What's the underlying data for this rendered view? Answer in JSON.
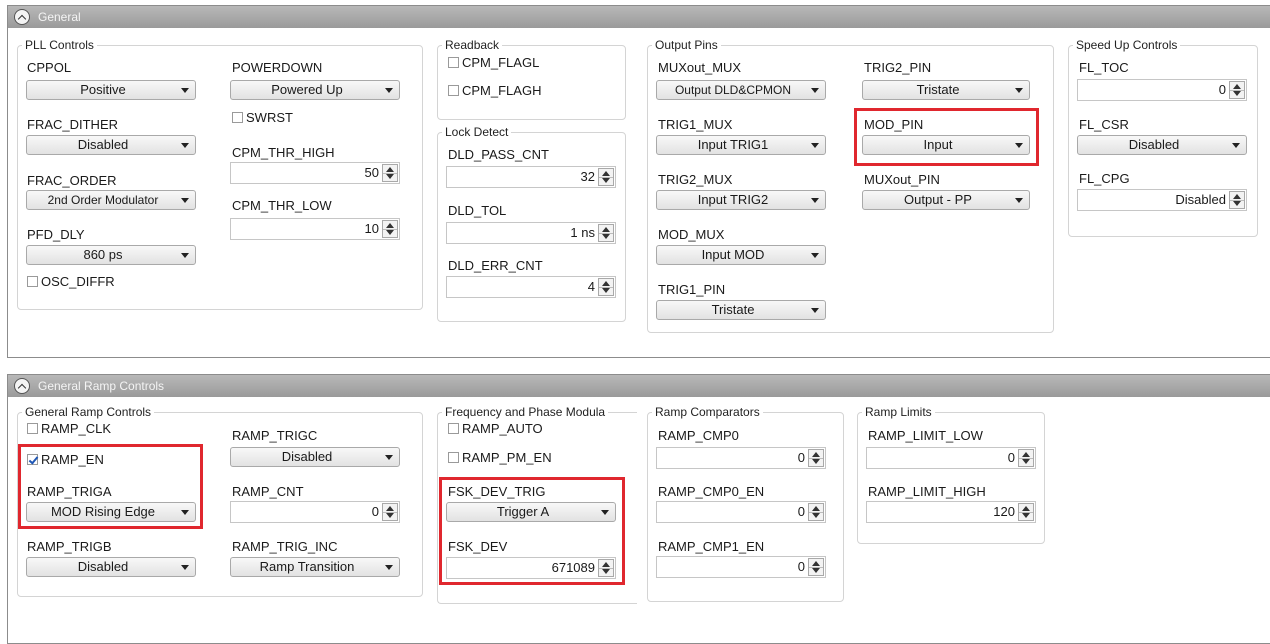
{
  "general": {
    "title": "General",
    "pll_controls": {
      "title": "PLL Controls",
      "cppol": {
        "label": "CPPOL",
        "value": "Positive"
      },
      "frac_dither": {
        "label": "FRAC_DITHER",
        "value": "Disabled"
      },
      "frac_order": {
        "label": "FRAC_ORDER",
        "value": "2nd Order Modulator"
      },
      "pfd_dly": {
        "label": "PFD_DLY",
        "value": "860 ps"
      },
      "osc_diffr": {
        "label": "OSC_DIFFR",
        "checked": false
      },
      "powerdown": {
        "label": "POWERDOWN",
        "value": "Powered Up"
      },
      "swrst": {
        "label": "SWRST",
        "checked": false
      },
      "cpm_thr_high": {
        "label": "CPM_THR_HIGH",
        "value": "50"
      },
      "cpm_thr_low": {
        "label": "CPM_THR_LOW",
        "value": "10"
      }
    },
    "readback": {
      "title": "Readback",
      "cpm_flagl": {
        "label": "CPM_FLAGL",
        "checked": false
      },
      "cpm_flagh": {
        "label": "CPM_FLAGH",
        "checked": false
      }
    },
    "lock_detect": {
      "title": "Lock Detect",
      "dld_pass_cnt": {
        "label": "DLD_PASS_CNT",
        "value": "32"
      },
      "dld_tol": {
        "label": "DLD_TOL",
        "value": "1 ns"
      },
      "dld_err_cnt": {
        "label": "DLD_ERR_CNT",
        "value": "4"
      }
    },
    "output_pins": {
      "title": "Output Pins",
      "muxout_mux": {
        "label": "MUXout_MUX",
        "value": "Output DLD&CPMON"
      },
      "trig1_mux": {
        "label": "TRIG1_MUX",
        "value": "Input TRIG1"
      },
      "trig2_mux": {
        "label": "TRIG2_MUX",
        "value": "Input TRIG2"
      },
      "mod_mux": {
        "label": "MOD_MUX",
        "value": "Input MOD"
      },
      "trig1_pin": {
        "label": "TRIG1_PIN",
        "value": "Tristate"
      },
      "trig2_pin": {
        "label": "TRIG2_PIN",
        "value": "Tristate"
      },
      "mod_pin": {
        "label": "MOD_PIN",
        "value": "Input"
      },
      "muxout_pin": {
        "label": "MUXout_PIN",
        "value": "Output - PP"
      }
    },
    "speed_up": {
      "title": "Speed Up Controls",
      "fl_toc": {
        "label": "FL_TOC",
        "value": "0"
      },
      "fl_csr": {
        "label": "FL_CSR",
        "value": "Disabled"
      },
      "fl_cpg": {
        "label": "FL_CPG",
        "value": "Disabled"
      }
    }
  },
  "ramp": {
    "title": "General Ramp Controls",
    "general": {
      "title": "General Ramp Controls",
      "ramp_clk": {
        "label": "RAMP_CLK",
        "checked": false
      },
      "ramp_en": {
        "label": "RAMP_EN",
        "checked": true
      },
      "ramp_triga": {
        "label": "RAMP_TRIGA",
        "value": "MOD Rising Edge"
      },
      "ramp_trigb": {
        "label": "RAMP_TRIGB",
        "value": "Disabled"
      },
      "ramp_trigc": {
        "label": "RAMP_TRIGC",
        "value": "Disabled"
      },
      "ramp_cnt": {
        "label": "RAMP_CNT",
        "value": "0"
      },
      "ramp_trig_inc": {
        "label": "RAMP_TRIG_INC",
        "value": "Ramp Transition"
      }
    },
    "freq_phase": {
      "title": "Frequency and Phase Modula",
      "ramp_auto": {
        "label": "RAMP_AUTO",
        "checked": false
      },
      "ramp_pm_en": {
        "label": "RAMP_PM_EN",
        "checked": false
      },
      "fsk_dev_trig": {
        "label": "FSK_DEV_TRIG",
        "value": "Trigger A"
      },
      "fsk_dev": {
        "label": "FSK_DEV",
        "value": "671089"
      }
    },
    "comparators": {
      "title": "Ramp Comparators",
      "ramp_cmp0": {
        "label": "RAMP_CMP0",
        "value": "0"
      },
      "ramp_cmp0_en": {
        "label": "RAMP_CMP0_EN",
        "value": "0"
      },
      "ramp_cmp1_en": {
        "label": "RAMP_CMP1_EN",
        "value": "0"
      }
    },
    "limits": {
      "title": "Ramp Limits",
      "ramp_limit_low": {
        "label": "RAMP_LIMIT_LOW",
        "value": "0"
      },
      "ramp_limit_high": {
        "label": "RAMP_LIMIT_HIGH",
        "value": "120"
      }
    }
  },
  "colors": {
    "highlight": "#e0272e",
    "header": "#a8a8a8"
  }
}
